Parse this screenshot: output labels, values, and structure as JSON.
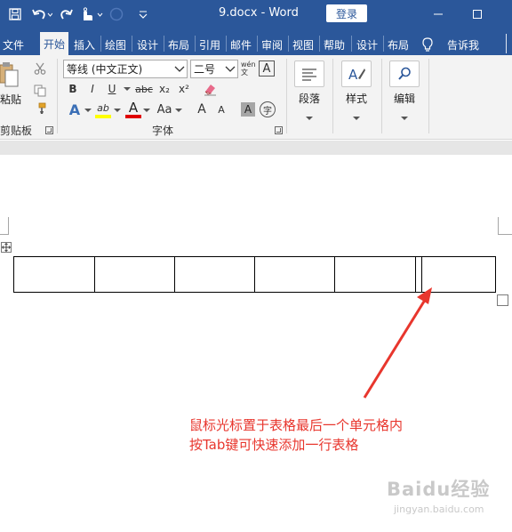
{
  "titlebar": {
    "document_title": "9.docx  -  Word",
    "login_label": "登录",
    "qat_icons": [
      "save-icon",
      "undo-icon",
      "redo-icon",
      "touch-mode-icon",
      "autosave-icon",
      "customize-icon"
    ],
    "window_controls": [
      "minimize-icon",
      "maximize-icon"
    ],
    "colors": {
      "titlebar_bg": "#2b579a",
      "text": "#ffffff"
    }
  },
  "tabs": [
    {
      "label": "文件"
    },
    {
      "label": "开始",
      "active": true
    },
    {
      "label": "插入"
    },
    {
      "label": "绘图"
    },
    {
      "label": "设计"
    },
    {
      "label": "布局"
    },
    {
      "label": "引用"
    },
    {
      "label": "邮件"
    },
    {
      "label": "审阅"
    },
    {
      "label": "视图"
    },
    {
      "label": "帮助"
    },
    {
      "label": "设计"
    },
    {
      "label": "布局"
    },
    {
      "label": "告诉我"
    }
  ],
  "ribbon": {
    "clipboard": {
      "paste_label": "粘贴",
      "group_label": "剪贴板"
    },
    "font": {
      "font_name": "等线 (中文正文)",
      "font_size": "二号",
      "phonetic_label": "wén 文",
      "border_char": "A",
      "bold": "B",
      "italic": "I",
      "underline": "U",
      "strikethrough": "abc",
      "subscript": "x₂",
      "superscript": "x²",
      "text_effects": "A",
      "highlight": "ab",
      "font_color": "A",
      "change_case": "Aa",
      "grow_font": "A",
      "shrink_font": "A",
      "char_shading": "A",
      "enclose_char": "字",
      "group_label": "字体",
      "colors": {
        "highlight": "#ffff00",
        "font_color": "#e00000",
        "accent": "#2b579a"
      }
    },
    "paragraph": {
      "label": "段落"
    },
    "styles": {
      "label": "样式"
    },
    "editing": {
      "label": "编辑"
    }
  },
  "document": {
    "table": {
      "rows": 1,
      "columns": 6,
      "cells": [
        "",
        "",
        "",
        "",
        "",
        ""
      ]
    },
    "annotation": {
      "line1": "鼠标光标置于表格最后一个单元格内",
      "line2": "按Tab键可快速添加一行表格",
      "color": "#e8362d"
    },
    "watermark": {
      "main": "Baidu经验",
      "sub": "jingyan.baidu.com"
    }
  }
}
